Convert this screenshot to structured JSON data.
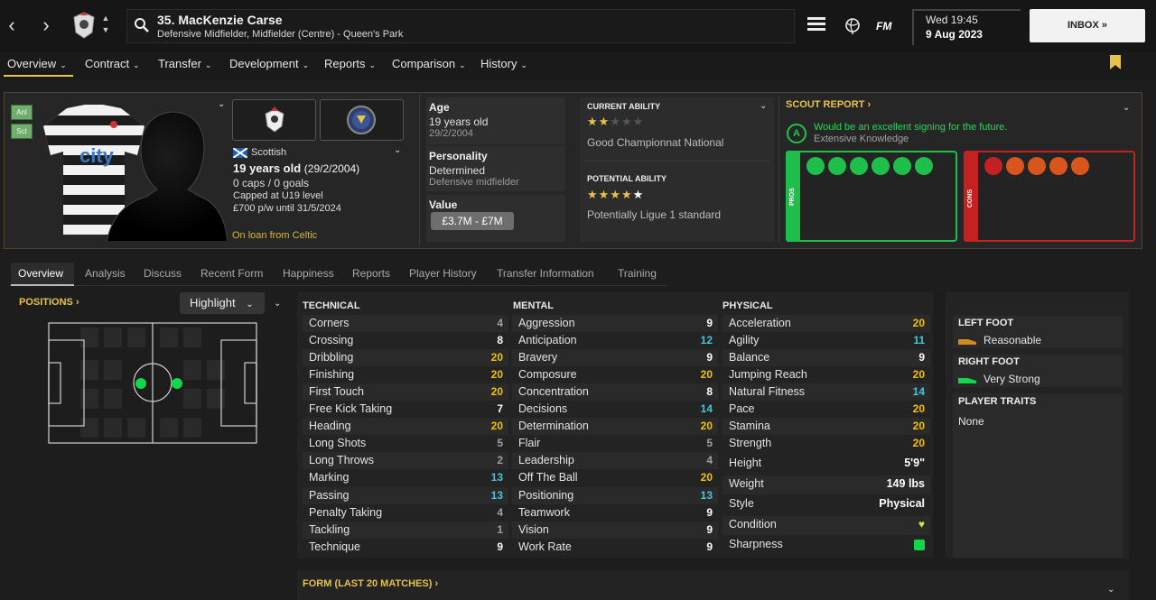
{
  "header": {
    "player_title": "35. MacKenzie Carse",
    "player_subtitle": "Defensive Midfielder, Midfielder (Centre) - Queen's Park",
    "date_day": "Wed 19:45",
    "date_full": "9 Aug 2023",
    "inbox_label": "INBOX",
    "fm_logo": "FM",
    "nav_back": "‹",
    "nav_forward": "›",
    "inbox_arrows": "»"
  },
  "menu": [
    {
      "label": "Overview"
    },
    {
      "label": "Contract"
    },
    {
      "label": "Transfer"
    },
    {
      "label": "Development"
    },
    {
      "label": "Reports"
    },
    {
      "label": "Comparison"
    },
    {
      "label": "History"
    }
  ],
  "side_tags": [
    "Anl",
    "Sct"
  ],
  "profile": {
    "nationality": "Scottish",
    "age_main": "19 years old",
    "age_dob": "(29/2/2004)",
    "caps": "0 caps / 0 goals",
    "capped": "Capped at U19 level",
    "wage": "£700 p/w until 31/5/2024",
    "loan": "On loan from Celtic",
    "shirt_sponsor": "city"
  },
  "info": {
    "age_label": "Age",
    "age_value": "19 years old",
    "age_dob": "29/2/2004",
    "personality_label": "Personality",
    "personality_value": "Determined",
    "personality_role": "Defensive midfielder",
    "value_label": "Value",
    "value_range": "£3.7M - £7M"
  },
  "ability": {
    "current_label": "CURRENT ABILITY",
    "current_stars": 2,
    "current_desc": "Good Championnat National",
    "potential_label": "POTENTIAL ABILITY",
    "potential_stars": 4,
    "potential_desc": "Potentially Ligue 1 standard",
    "star_gold": "#e8c24a",
    "star_empty": "#555555"
  },
  "scout": {
    "title": "SCOUT REPORT",
    "grade": "A",
    "summary": "Would be an excellent signing for the future.",
    "knowledge": "Extensive Knowledge",
    "pros_label": "PROS",
    "cons_label": "CONS",
    "pros_color": "#1fbf4c",
    "cons_color": "#c42222",
    "pros_icons": [
      "briefcase-icon",
      "syringe-icon",
      "tactics-icon",
      "team-icon",
      "head-icon",
      "boots-icon"
    ],
    "cons_icons": [
      "magnet-icon",
      "report-icon",
      "speech-icon",
      "scissors-icon",
      "fire-icon"
    ]
  },
  "tabs": [
    "Overview",
    "Analysis",
    "Discuss",
    "Recent Form",
    "Happiness",
    "Reports",
    "Player History",
    "Transfer Information",
    "Training"
  ],
  "positions": {
    "title": "POSITIONS",
    "highlight_label": "Highlight"
  },
  "attributes": {
    "technical_label": "TECHNICAL",
    "mental_label": "MENTAL",
    "physical_label": "PHYSICAL",
    "technical": [
      {
        "name": "Corners",
        "value": "4"
      },
      {
        "name": "Crossing",
        "value": "8"
      },
      {
        "name": "Dribbling",
        "value": "20"
      },
      {
        "name": "Finishing",
        "value": "20"
      },
      {
        "name": "First Touch",
        "value": "20"
      },
      {
        "name": "Free Kick Taking",
        "value": "7"
      },
      {
        "name": "Heading",
        "value": "20"
      },
      {
        "name": "Long Shots",
        "value": "5"
      },
      {
        "name": "Long Throws",
        "value": "2"
      },
      {
        "name": "Marking",
        "value": "13"
      },
      {
        "name": "Passing",
        "value": "13"
      },
      {
        "name": "Penalty Taking",
        "value": "4"
      },
      {
        "name": "Tackling",
        "value": "1"
      },
      {
        "name": "Technique",
        "value": "9"
      }
    ],
    "mental": [
      {
        "name": "Aggression",
        "value": "9"
      },
      {
        "name": "Anticipation",
        "value": "12"
      },
      {
        "name": "Bravery",
        "value": "9"
      },
      {
        "name": "Composure",
        "value": "20"
      },
      {
        "name": "Concentration",
        "value": "8"
      },
      {
        "name": "Decisions",
        "value": "14"
      },
      {
        "name": "Determination",
        "value": "20"
      },
      {
        "name": "Flair",
        "value": "5"
      },
      {
        "name": "Leadership",
        "value": "4"
      },
      {
        "name": "Off The Ball",
        "value": "20"
      },
      {
        "name": "Positioning",
        "value": "13"
      },
      {
        "name": "Teamwork",
        "value": "9"
      },
      {
        "name": "Vision",
        "value": "9"
      },
      {
        "name": "Work Rate",
        "value": "9"
      }
    ],
    "physical": [
      {
        "name": "Acceleration",
        "value": "20"
      },
      {
        "name": "Agility",
        "value": "11"
      },
      {
        "name": "Balance",
        "value": "9"
      },
      {
        "name": "Jumping Reach",
        "value": "20"
      },
      {
        "name": "Natural Fitness",
        "value": "14"
      },
      {
        "name": "Pace",
        "value": "20"
      },
      {
        "name": "Stamina",
        "value": "20"
      },
      {
        "name": "Strength",
        "value": "20"
      }
    ],
    "extras": [
      {
        "name": "Height",
        "value": "5'9\""
      },
      {
        "name": "Weight",
        "value": "149 lbs"
      },
      {
        "name": "Style",
        "value": "Physical"
      },
      {
        "name": "Condition",
        "value": ""
      },
      {
        "name": "Sharpness",
        "value": ""
      }
    ],
    "colors": {
      "high": "#f2c200",
      "mid": "#3fc7e0",
      "low_bright": "#ffffff",
      "low": "#a0a0a0"
    }
  },
  "feet": {
    "left_label": "LEFT FOOT",
    "left_value": "Reasonable",
    "right_label": "RIGHT FOOT",
    "right_value": "Very Strong",
    "traits_label": "PLAYER TRAITS",
    "traits_value": "None"
  },
  "form": {
    "title": "FORM (LAST 20 MATCHES)"
  }
}
